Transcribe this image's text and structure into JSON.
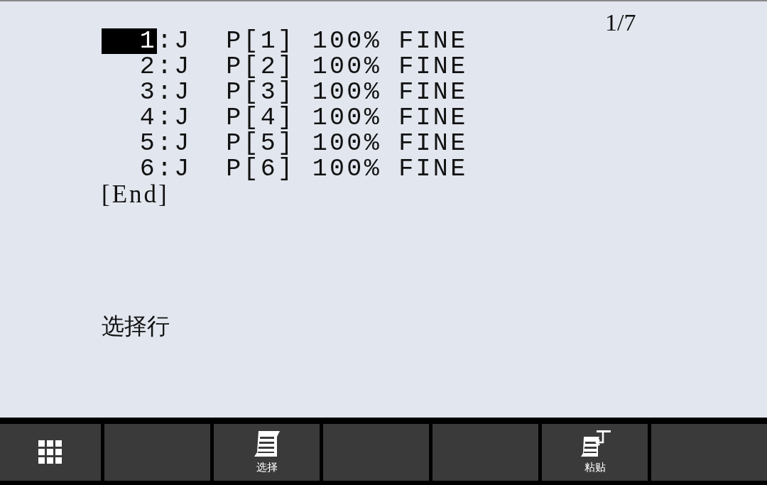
{
  "page_indicator": "1/7",
  "lines": [
    {
      "number": "1",
      "instruction": ":J  P[1] 100% FINE",
      "selected": true
    },
    {
      "number": "2",
      "instruction": ":J  P[2] 100% FINE",
      "selected": false
    },
    {
      "number": "3",
      "instruction": ":J  P[3] 100% FINE",
      "selected": false
    },
    {
      "number": "4",
      "instruction": ":J  P[4] 100% FINE",
      "selected": false
    },
    {
      "number": "5",
      "instruction": ":J  P[5] 100% FINE",
      "selected": false
    },
    {
      "number": "6",
      "instruction": ":J  P[6] 100% FINE",
      "selected": false
    }
  ],
  "end_marker": "[End]",
  "prompt": "选择行",
  "function_keys": [
    {
      "kind": "menu"
    },
    {
      "kind": "blank"
    },
    {
      "kind": "select",
      "label": "选择"
    },
    {
      "kind": "blank"
    },
    {
      "kind": "blank"
    },
    {
      "kind": "paste",
      "label": "粘贴"
    },
    {
      "kind": "blank"
    }
  ]
}
